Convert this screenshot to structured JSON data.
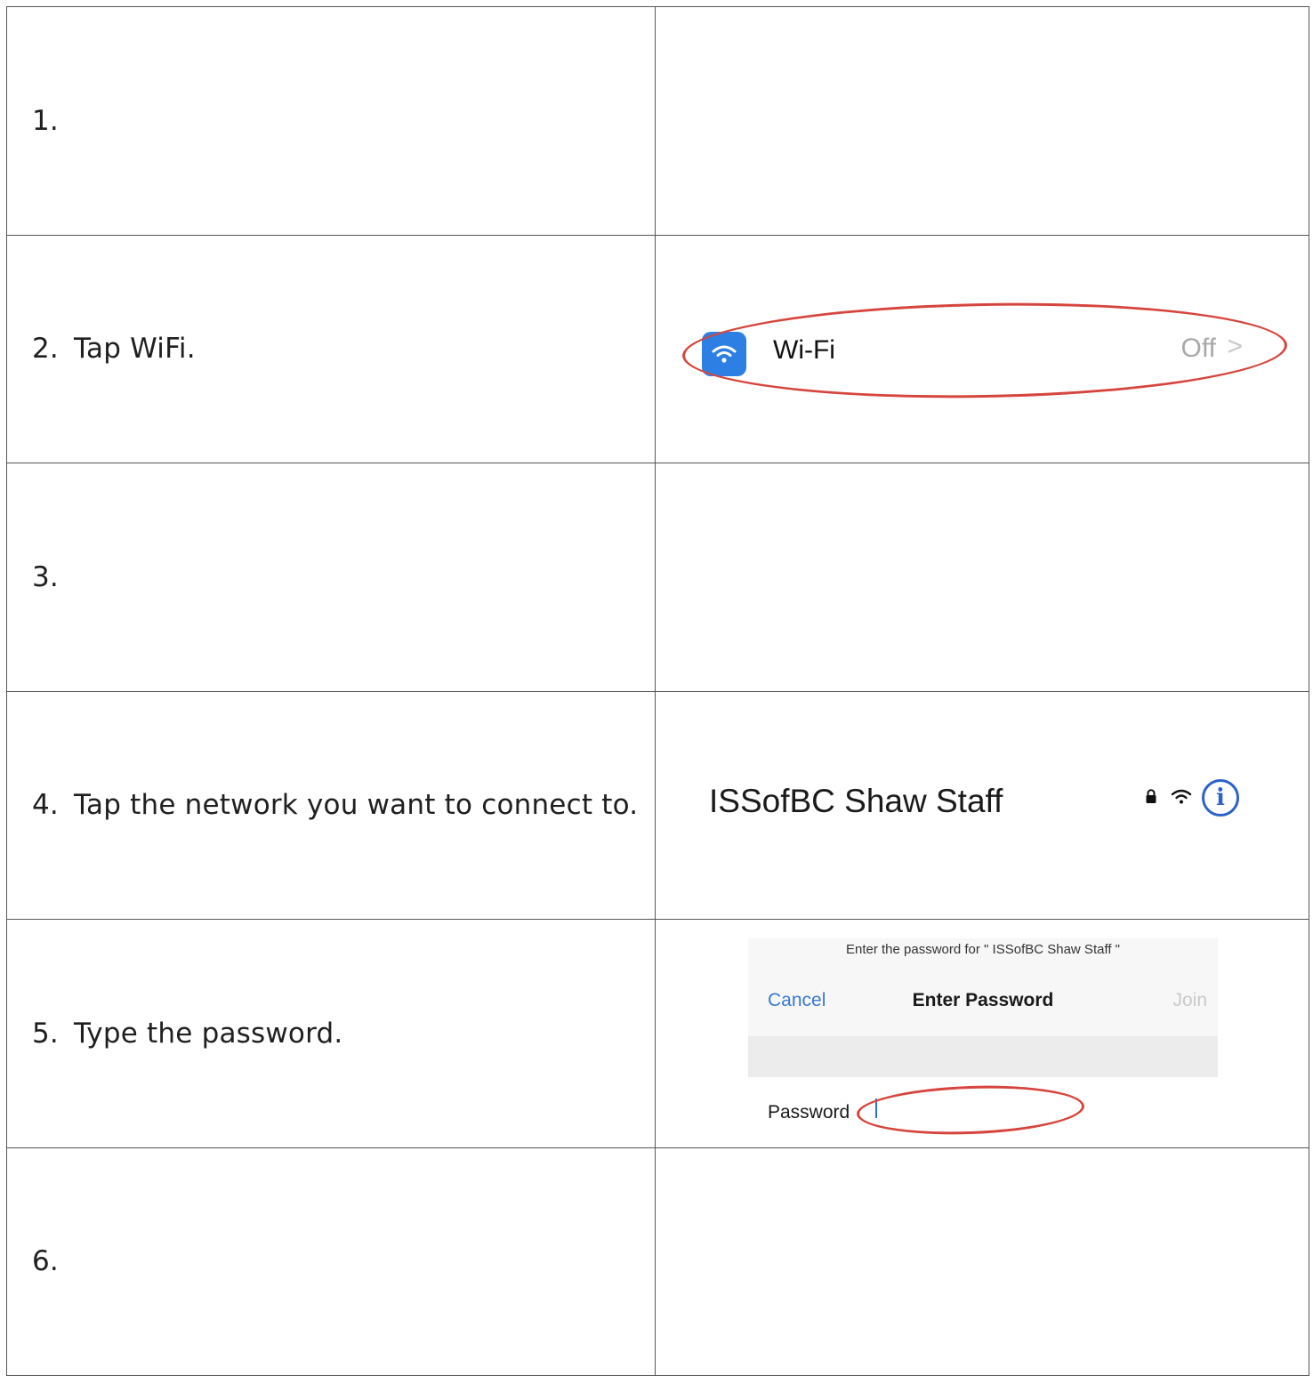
{
  "steps": [
    {
      "number": "1.",
      "text": ""
    },
    {
      "number": "2.",
      "text": "Tap WiFi."
    },
    {
      "number": "3.",
      "text": ""
    },
    {
      "number": "4.",
      "text": "Tap the network you want to connect to."
    },
    {
      "number": "5.",
      "text": "Type the password."
    },
    {
      "number": "6.",
      "text": ""
    }
  ],
  "wifi_setting": {
    "icon": "wifi-icon",
    "label": "Wi-Fi",
    "status": "Off",
    "chevron": ">",
    "highlight_color": "#d6453d",
    "icon_color": "#2e7fe3"
  },
  "network": {
    "name": "ISSofBC Shaw Staff",
    "icons": [
      "lock-icon",
      "wifi-icon",
      "info-icon"
    ],
    "info_glyph": "i",
    "info_color": "#2b62c8"
  },
  "password_dialog": {
    "prompt": "Enter the password for \" ISSofBC Shaw Staff \"",
    "cancel_label": "Cancel",
    "title": "Enter Password",
    "join_label": "Join",
    "field_label": "Password",
    "field_value": "",
    "cancel_color": "#3a78d6",
    "highlight_color": "#d6453d"
  }
}
